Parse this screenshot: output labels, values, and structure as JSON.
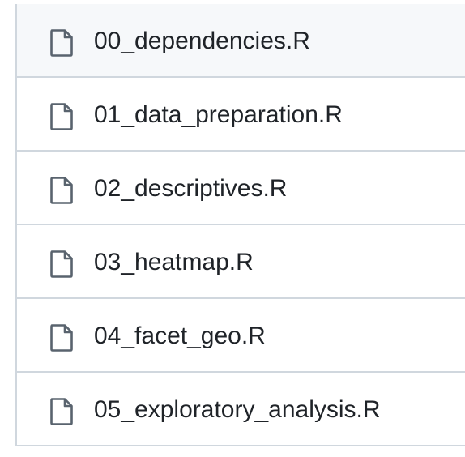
{
  "file_list": {
    "items": [
      {
        "name": "00_dependencies.R",
        "icon": "file-icon",
        "highlighted": true
      },
      {
        "name": "01_data_preparation.R",
        "icon": "file-icon",
        "highlighted": false
      },
      {
        "name": "02_descriptives.R",
        "icon": "file-icon",
        "highlighted": false
      },
      {
        "name": "03_heatmap.R",
        "icon": "file-icon",
        "highlighted": false
      },
      {
        "name": "04_facet_geo.R",
        "icon": "file-icon",
        "highlighted": false
      },
      {
        "name": "05_exploratory_analysis.R",
        "icon": "file-icon",
        "highlighted": false
      }
    ]
  },
  "colors": {
    "border": "#d0d7de",
    "highlight_bg": "#f6f8fa",
    "text": "#1f2328",
    "icon": "#59636e"
  }
}
